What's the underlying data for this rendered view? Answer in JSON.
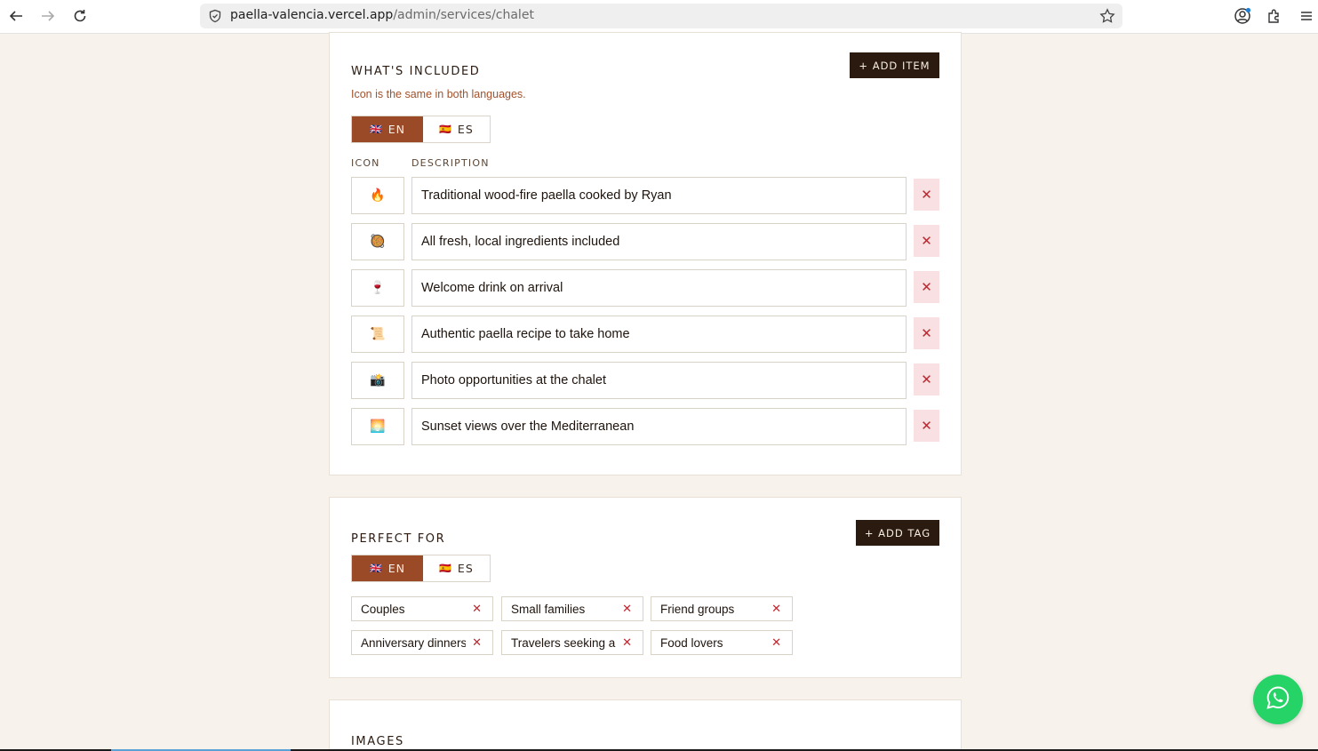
{
  "browser": {
    "url_host": "paella-valencia.vercel.app",
    "url_path": "/admin/services/chalet"
  },
  "included": {
    "title": "WHAT'S INCLUDED",
    "add_label": "+ ADD ITEM",
    "hint": "Icon is the same in both languages.",
    "lang_en": "EN",
    "lang_es": "ES",
    "col_icon": "ICON",
    "col_desc": "DESCRIPTION",
    "items": [
      {
        "icon": "🔥",
        "desc": "Traditional wood-fire paella cooked by Ryan"
      },
      {
        "icon": "🥘",
        "desc": "All fresh, local ingredients included"
      },
      {
        "icon": "🍷",
        "desc": "Welcome drink on arrival"
      },
      {
        "icon": "📜",
        "desc": "Authentic paella recipe to take home"
      },
      {
        "icon": "📸",
        "desc": "Photo opportunities at the chalet"
      },
      {
        "icon": "🌅",
        "desc": "Sunset views over the Mediterranean"
      }
    ],
    "delete_glyph": "✕"
  },
  "perfect_for": {
    "title": "PERFECT FOR",
    "add_label": "+ ADD TAG",
    "lang_en": "EN",
    "lang_es": "ES",
    "tags": [
      "Couples",
      "Small families",
      "Friend groups",
      "Anniversary dinners",
      "Travelers seeking a",
      "Food lovers"
    ],
    "remove_glyph": "✕"
  },
  "images": {
    "title": "IMAGES"
  },
  "flags": {
    "en": "🇬🇧",
    "es": "🇪🇸"
  },
  "colors": {
    "accent": "#9a4a27",
    "dark": "#2b1a0f",
    "delete_bg": "#f9e1e3",
    "delete_fg": "#c0262e",
    "page_bg": "#f7f3ec",
    "whatsapp": "#25d366"
  }
}
